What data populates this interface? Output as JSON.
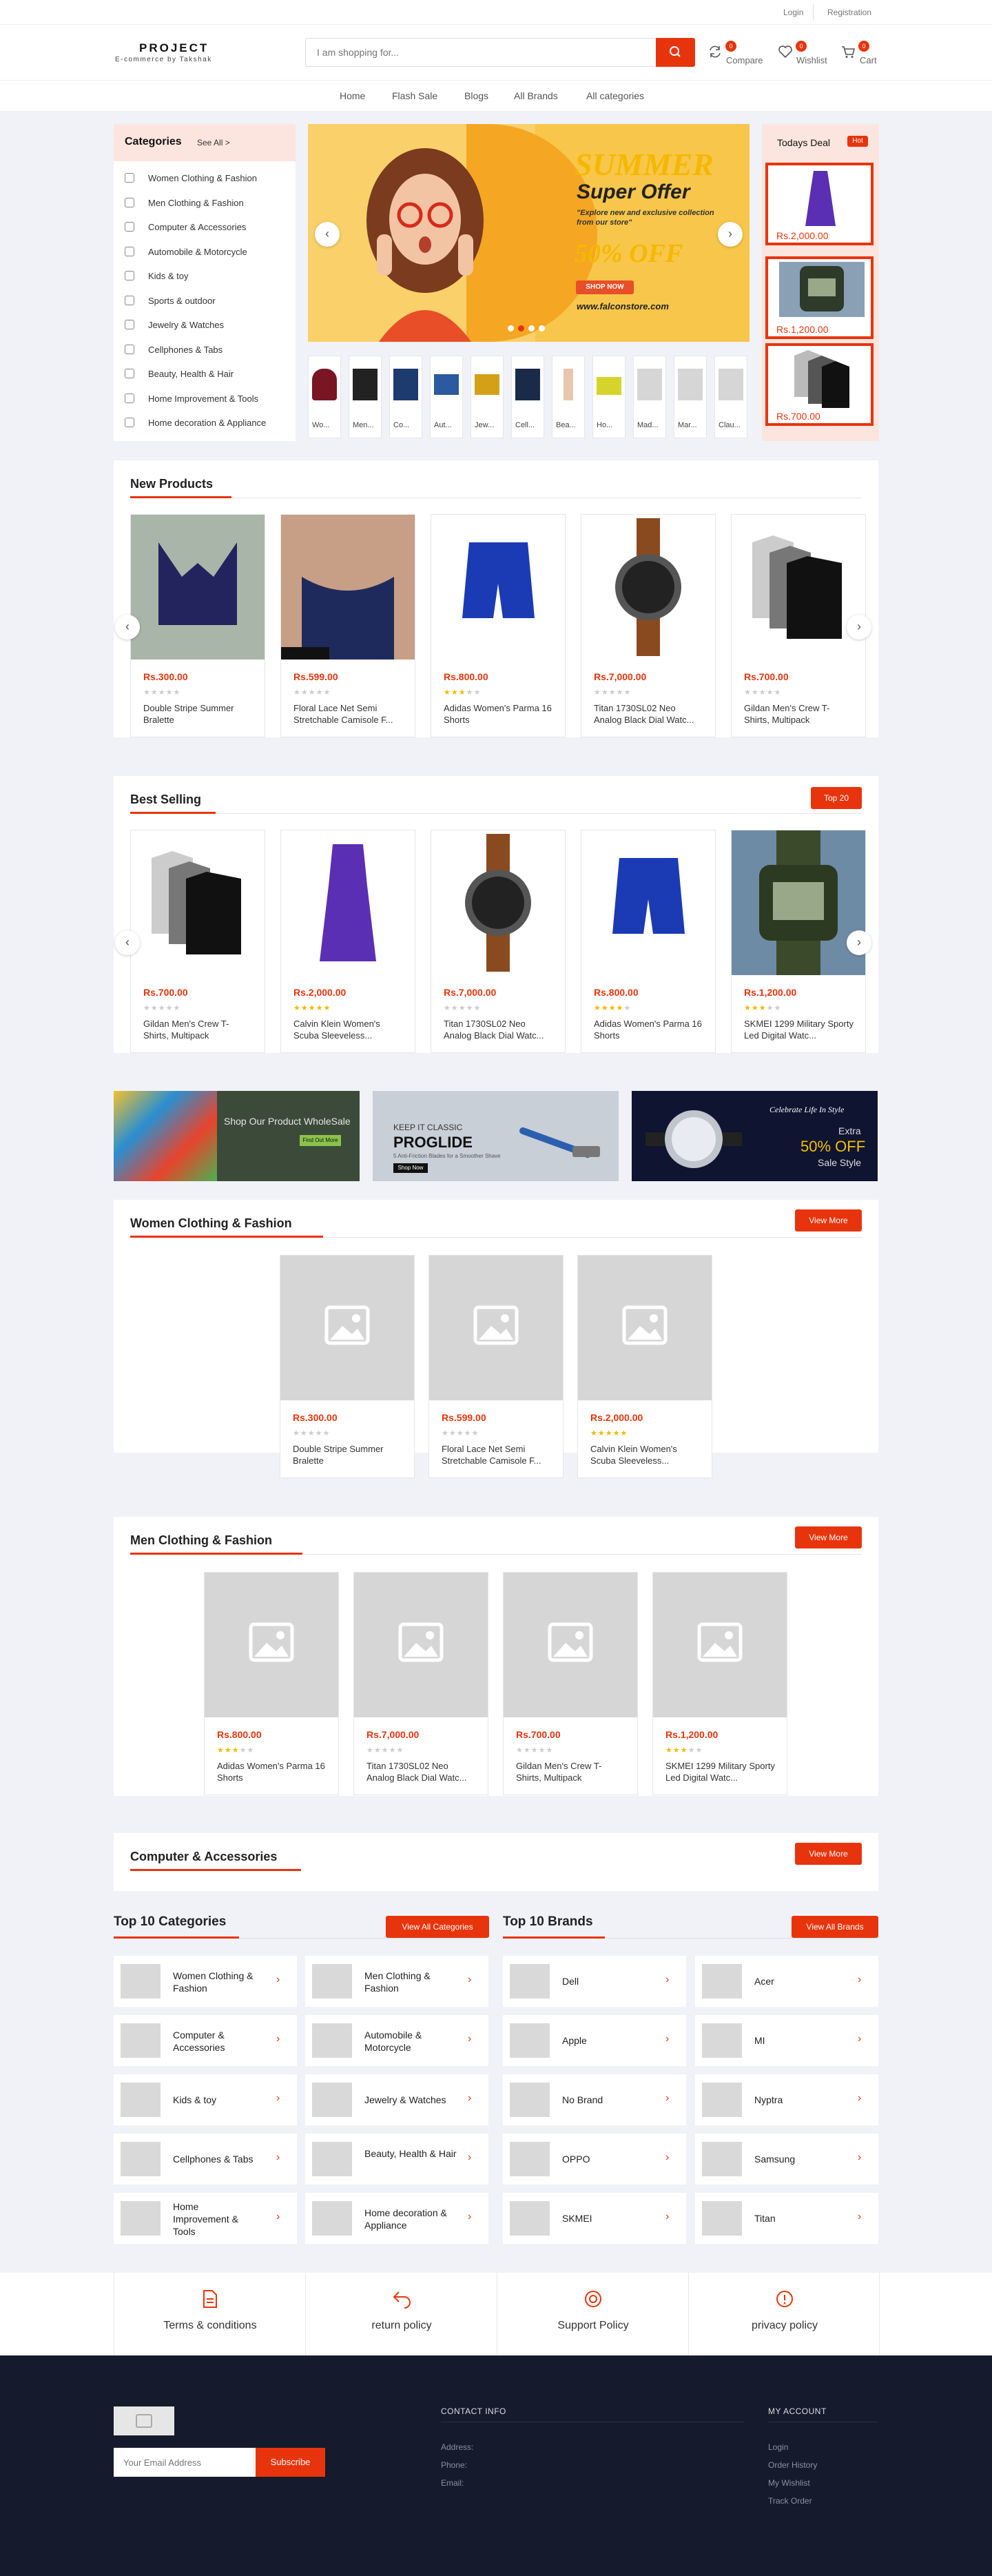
{
  "topbar": {
    "login": "Login",
    "registration": "Registration"
  },
  "header": {
    "logo_title": "PROJECT",
    "logo_sub": "E-commerce by Takshak",
    "search_placeholder": "I am shopping for...",
    "compare": "Compare",
    "compare_count": "0",
    "wishlist": "Wishlist",
    "wishlist_count": "0",
    "cart": "Cart",
    "cart_count": "0"
  },
  "nav": [
    "Home",
    "Flash Sale",
    "Blogs",
    "All Brands",
    "All categories"
  ],
  "categories": {
    "title": "Categories",
    "see_all": "See All >",
    "items": [
      "Women Clothing & Fashion",
      "Men Clothing & Fashion",
      "Computer & Accessories",
      "Automobile & Motorcycle",
      "Kids & toy",
      "Sports & outdoor",
      "Jewelry & Watches",
      "Cellphones & Tabs",
      "Beauty, Health & Hair",
      "Home Improvement & Tools",
      "Home decoration & Appliance"
    ]
  },
  "slider": {
    "summer": "SUMMER",
    "super_offer": "Super Offer",
    "tagline": "\"Explore new and exclusive collection from our store\"",
    "discount": "50% OFF",
    "shop_now": "SHOP NOW",
    "url": "www.falconstore.com"
  },
  "thumbs": [
    "Wo...",
    "Men...",
    "Co...",
    "Aut...",
    "Jew...",
    "Cell...",
    "Bea...",
    "Ho...",
    "Mad...",
    "Mar...",
    "Clau..."
  ],
  "deal": {
    "title": "Todays Deal",
    "hot": "Hot",
    "prices": [
      "Rs.2,000.00",
      "Rs.1,200.00",
      "Rs.700.00"
    ]
  },
  "new_products": {
    "title": "New Products",
    "items": [
      {
        "price": "Rs.300.00",
        "name": "Double Stripe Summer Bralette",
        "rating": 0
      },
      {
        "price": "Rs.599.00",
        "name": "Floral Lace Net Semi Stretchable Camisole F...",
        "rating": 0
      },
      {
        "price": "Rs.800.00",
        "name": "Adidas Women's Parma 16 Shorts",
        "rating": 3
      },
      {
        "price": "Rs.7,000.00",
        "name": "Titan 1730SL02 Neo Analog Black Dial Watc...",
        "rating": 0
      },
      {
        "price": "Rs.700.00",
        "name": "Gildan Men's Crew T-Shirts, Multipack",
        "rating": 0
      }
    ]
  },
  "best_selling": {
    "title": "Best Selling",
    "button": "Top 20",
    "items": [
      {
        "price": "Rs.700.00",
        "name": "Gildan Men's Crew T-Shirts, Multipack",
        "rating": 0
      },
      {
        "price": "Rs.2,000.00",
        "name": "Calvin Klein Women's Scuba Sleeveless...",
        "rating": 5
      },
      {
        "price": "Rs.7,000.00",
        "name": "Titan 1730SL02 Neo Analog Black Dial Watc...",
        "rating": 0
      },
      {
        "price": "Rs.800.00",
        "name": "Adidas Women's Parma 16 Shorts",
        "rating": 4
      },
      {
        "price": "Rs.1,200.00",
        "name": "SKMEI 1299 Military Sporty Led Digital Watc...",
        "rating": 3
      }
    ]
  },
  "banners": {
    "b1_text": "Shop Our Product WholeSale",
    "b1_btn": "Find Out More",
    "b2_small": "KEEP IT CLASSIC",
    "b2_big": "PROGLIDE",
    "b2_desc": "5 Anti-Friction Blades for a Smoother Shave",
    "b2_btn": "Shop Now",
    "b3_script": "Celebrate Life In Style",
    "b3_extra": "Extra",
    "b3_off": "50% OFF",
    "b3_sale": "Sale Style"
  },
  "women": {
    "title": "Women Clothing & Fashion",
    "button": "View More",
    "items": [
      {
        "price": "Rs.300.00",
        "name": "Double Stripe Summer Bralette",
        "rating": 0
      },
      {
        "price": "Rs.599.00",
        "name": "Floral Lace Net Semi Stretchable Camisole F...",
        "rating": 0
      },
      {
        "price": "Rs.2,000.00",
        "name": "Calvin Klein Women's Scuba Sleeveless...",
        "rating": 5
      }
    ]
  },
  "men": {
    "title": "Men Clothing & Fashion",
    "button": "View More",
    "items": [
      {
        "price": "Rs.800.00",
        "name": "Adidas Women's Parma 16 Shorts",
        "rating": 3
      },
      {
        "price": "Rs.7,000.00",
        "name": "Titan 1730SL02 Neo Analog Black Dial Watc...",
        "rating": 0
      },
      {
        "price": "Rs.700.00",
        "name": "Gildan Men's Crew T-Shirts, Multipack",
        "rating": 0
      },
      {
        "price": "Rs.1,200.00",
        "name": "SKMEI 1299 Military Sporty Led Digital Watc...",
        "rating": 3
      }
    ]
  },
  "computer": {
    "title": "Computer & Accessories",
    "button": "View More"
  },
  "top_categories": {
    "title": "Top 10 Categories",
    "button": "View All Categories",
    "items": [
      "Women Clothing & Fashion",
      "Men Clothing & Fashion",
      "Computer & Accessories",
      "Automobile & Motorcycle",
      "Kids & toy",
      "Jewelry & Watches",
      "Cellphones & Tabs",
      "Beauty, Health & Hair",
      "Home Improvement & Tools",
      "Home decoration & Appliance"
    ]
  },
  "top_brands": {
    "title": "Top 10 Brands",
    "button": "View All Brands",
    "items": [
      "Dell",
      "Acer",
      "Apple",
      "MI",
      "No Brand",
      "Nyptra",
      "OPPO",
      "Samsung",
      "SKMEI",
      "Titan"
    ]
  },
  "policies": [
    "Terms & conditions",
    "return policy",
    "Support Policy",
    "privacy policy"
  ],
  "footer": {
    "email_placeholder": "Your Email Address",
    "subscribe": "Subscribe",
    "contact_title": "CONTACT INFO",
    "contact": [
      "Address:",
      "Phone:",
      "Email:"
    ],
    "account_title": "MY ACCOUNT",
    "account": [
      "Login",
      "Order History",
      "My Wishlist",
      "Track Order"
    ]
  },
  "colors": {
    "accent": "#e8340c",
    "deal_bg": "#fde5df",
    "page_bg": "#f1f2f7",
    "footer_bg": "#151b2c"
  }
}
